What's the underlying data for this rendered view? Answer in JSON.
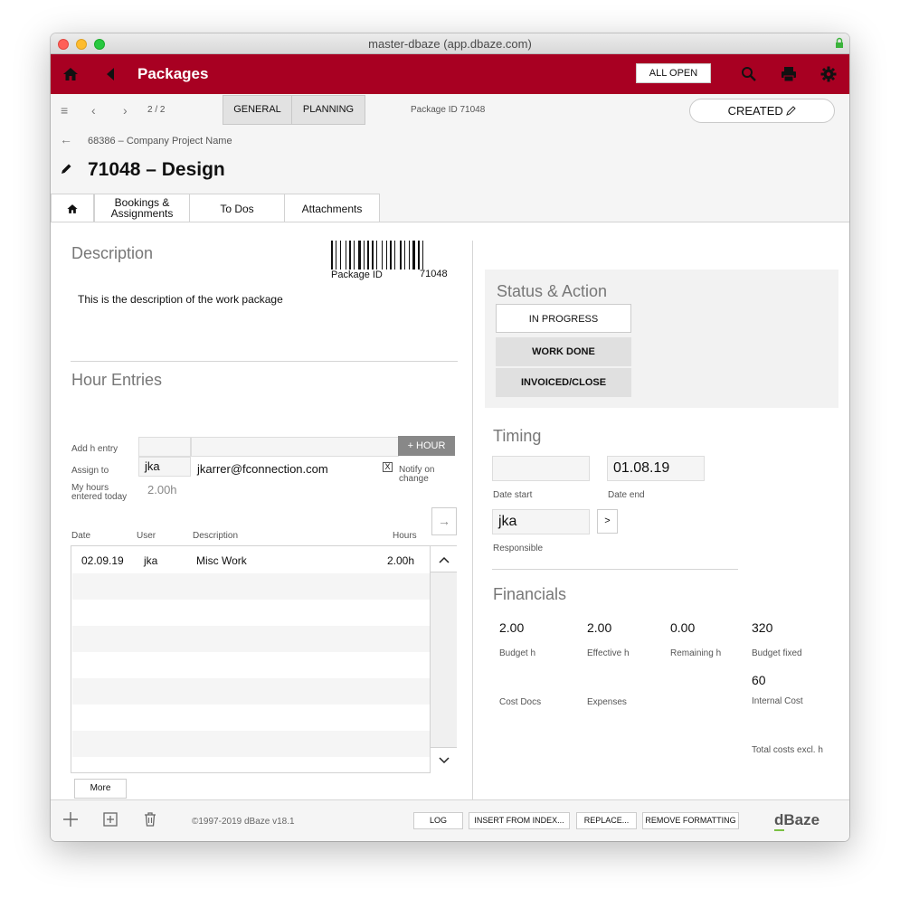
{
  "window": {
    "title": "master-dbaze (app.dbaze.com)"
  },
  "appbar": {
    "title": "Packages",
    "all_open_label": "ALL OPEN",
    "accent_color": "#a80022",
    "icons": [
      "home-icon",
      "back-triangle-icon",
      "search-icon",
      "print-icon",
      "gear-icon"
    ]
  },
  "toolbar": {
    "pager": "2 / 2",
    "tabs": [
      {
        "label": "GENERAL"
      },
      {
        "label": "PLANNING"
      }
    ],
    "package_id": "Package ID 71048",
    "status": "CREATED"
  },
  "record": {
    "breadcrumb": "68386 – Company Project Name",
    "title": "71048 – Design",
    "subtabs": [
      {
        "label": "Bookings & Assignments"
      },
      {
        "label": "To Dos"
      },
      {
        "label": "Attachments"
      }
    ]
  },
  "description": {
    "heading": "Description",
    "barcode_label": "Package ID",
    "barcode_value": "71048",
    "text": "This is the description of the work package"
  },
  "hours": {
    "heading": "Hour Entries",
    "add_label": "Add h entry",
    "assign_label": "Assign to",
    "assign_value": "jka",
    "assign_email": "jkarrer@fconnection.com",
    "hour_button": "+ HOUR",
    "notify_mark": "X",
    "notify_label": "Notify on change",
    "my_hours_label": "My hours entered today",
    "my_hours_value": "2.00h",
    "columns": [
      "Date",
      "User",
      "Description",
      "Hours"
    ],
    "rows": [
      {
        "date": "02.09.19",
        "user": "jka",
        "description": "Misc Work",
        "hours": "2.00h"
      }
    ],
    "more_label": "More"
  },
  "status_action": {
    "heading": "Status & Action",
    "buttons": [
      "IN PROGRESS",
      "WORK DONE",
      "INVOICED/CLOSE"
    ]
  },
  "timing": {
    "heading": "Timing",
    "date_start_value": "",
    "date_start_label": "Date start",
    "date_end_value": "01.08.19",
    "date_end_label": "Date end",
    "responsible_value": "jka",
    "responsible_label": "Responsible",
    "responsible_btn": ">"
  },
  "financials": {
    "heading": "Financials",
    "items": [
      {
        "value": "2.00",
        "label": "Budget h"
      },
      {
        "value": "2.00",
        "label": "Effective h"
      },
      {
        "value": "0.00",
        "label": "Remaining h"
      },
      {
        "value": "320",
        "label": "Budget fixed"
      },
      {
        "value": "",
        "label": "Cost Docs"
      },
      {
        "value": "",
        "label": "Expenses"
      },
      {
        "value": "60",
        "label": "Internal Cost"
      },
      {
        "value": "",
        "label": "Total costs excl. h"
      }
    ]
  },
  "footer": {
    "copyright": "©1997-2019 dBaze v18.1",
    "buttons": [
      "LOG",
      "INSERT FROM INDEX...",
      "REPLACE...",
      "REMOVE FORMATTING"
    ],
    "brand": "dBaze"
  }
}
